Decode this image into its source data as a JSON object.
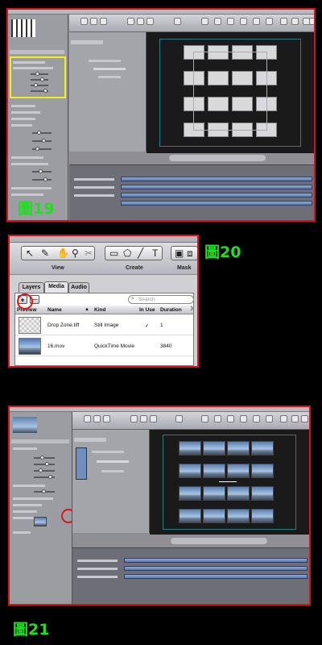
{
  "figures": {
    "fig19": "圖19",
    "fig20": "圖20",
    "fig21": "圖21"
  },
  "fig20": {
    "toolbar_groups": {
      "view": "View",
      "create": "Create",
      "mask": "Mask"
    },
    "tabs": [
      "Layers",
      "Media",
      "Audio"
    ],
    "active_tab": "Media",
    "add_button": "+",
    "remove_button": "—",
    "search": {
      "placeholder": "Search"
    },
    "columns": [
      "Preview",
      "Name",
      "Kind",
      "In Use",
      "Duration"
    ],
    "rows": [
      {
        "name": "Drop Zone.tiff",
        "kind": "Still Image",
        "in_use": "✓",
        "duration": "1"
      },
      {
        "name": "16.mov",
        "kind": "QuickTime Movie",
        "in_use": "",
        "duration": "3840"
      }
    ]
  },
  "colors": {
    "highlight_red": "#d8121a",
    "highlight_yellow": "#f2ee1a",
    "label_green": "#22dd22"
  }
}
